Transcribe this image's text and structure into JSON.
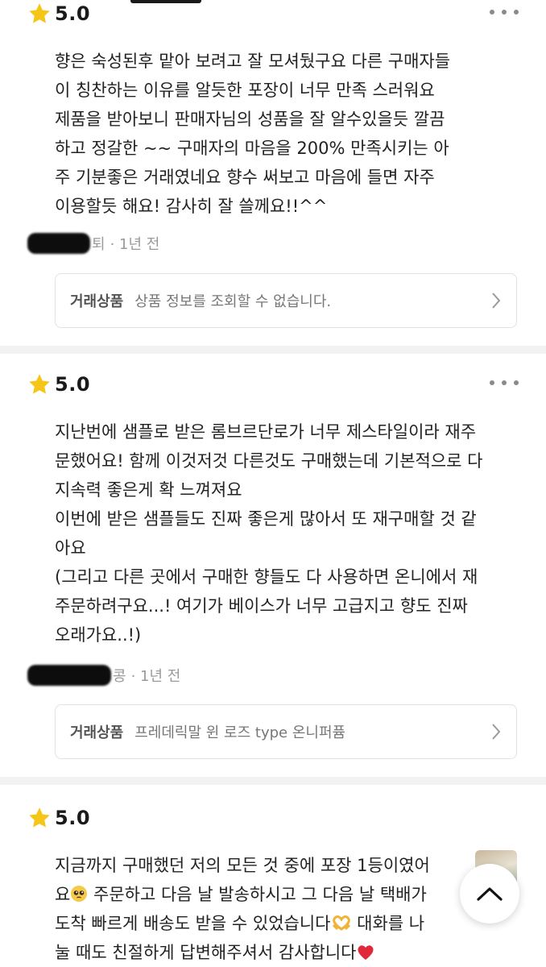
{
  "reviews": [
    {
      "rating": "5.0",
      "lines": [
        "향은 숙성된후 맡아 보려고 잘 모셔뒀구요 다른 구매자들",
        "이 칭찬하는 이유를 알듯한 포장이 너무 만족 스러워요",
        "제품을 받아보니 판매자님의 성품을 잘 알수있을듯 깔끔",
        "하고 정갈한 ~~ 구매자의 마음을 200% 만족시키는 아",
        "주 기분좋은 거래였네요 향수 써보고 마음에 들면 자주",
        "이용할듯 해요! 감사히 잘 쓸께요!!^^"
      ],
      "author_tail": "퇴",
      "time": "· 1년 전",
      "product_label": "거래상품",
      "product_value": "상품 정보를 조회할 수 없습니다."
    },
    {
      "rating": "5.0",
      "lines": [
        "지난번에 샘플로 받은 롬브르단로가 너무 제스타일이라 재주",
        "문했어요! 함께 이것저것 다른것도 구매했는데 기본적으로 다",
        "지속력 좋은게 확 느껴져요",
        "이번에 받은 샘플들도 진짜 좋은게 많아서 또 재구매할 것 같",
        "아요",
        "(그리고 다른 곳에서 구매한 향들도 다 사용하면 온니에서 재",
        "주문하려구요...! 여기가 베이스가 너무 고급지고 향도 진짜",
        "오래가요..!)"
      ],
      "author_tail": "콩",
      "time": "· 1년 전",
      "product_label": "거래상품",
      "product_value": "프레데릭말 윈 로즈 type 온니퍼퓸"
    },
    {
      "rating": "5.0",
      "line1": "지금까지 구매했던 저의 모든 것 중에 포장 1등이였어",
      "line2_a": "요",
      "line2_b": " 주문하고 다음 날 발송하시고 그 다음 날 택배가",
      "line3_a": "도착 빠르게 배송도 받을 수 있었습니다",
      "line3_b": " 대화를 나",
      "line4": "눌 때도 친절하게 답변해주셔서 감사합니다"
    }
  ],
  "icons": {
    "star": "star-icon",
    "more": "more-horizontal-icon",
    "chevron": "chevron-right-icon",
    "scroll_top": "chevron-up-icon",
    "pleading_face": "pleading-face-emoji",
    "heart_hands": "heart-hands-emoji",
    "red_heart": "red-heart-emoji"
  },
  "colors": {
    "star": "#F5C518",
    "meta_text": "#9A9A9A",
    "divider": "#F2F2F2",
    "heart": "#E0283A"
  }
}
